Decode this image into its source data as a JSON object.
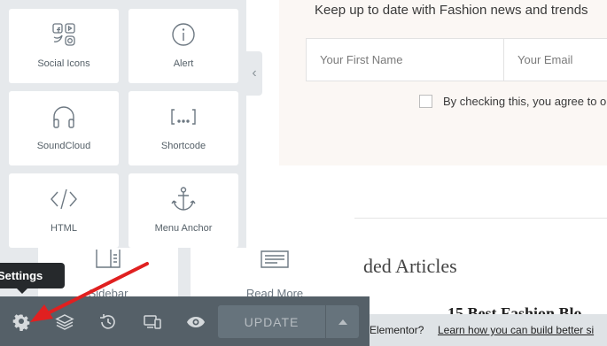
{
  "preview": {
    "newsletter_heading": "Keep up to date with Fashion news and trends",
    "first_name_placeholder": "Your First Name",
    "email_placeholder": "Your Email",
    "consent_text": "By checking this, you agree to o",
    "related_heading": "ded Articles",
    "post_title": "15 Best Fashion Blo",
    "notice_text": "g Elementor?",
    "notice_link": "Learn how you can build better si"
  },
  "panel": {
    "widgets": [
      {
        "label": "Social Icons",
        "icon": "social-icons-icon"
      },
      {
        "label": "Alert",
        "icon": "alert-icon"
      },
      {
        "label": "SoundCloud",
        "icon": "headphones-icon"
      },
      {
        "label": "Shortcode",
        "icon": "shortcode-icon"
      },
      {
        "label": "HTML",
        "icon": "code-icon"
      },
      {
        "label": "Menu Anchor",
        "icon": "anchor-icon"
      }
    ],
    "partial_widgets": [
      {
        "label": "Sidebar",
        "icon": "sidebar-icon"
      },
      {
        "label": "Read More",
        "icon": "read-more-icon"
      }
    ]
  },
  "footer": {
    "update_label": "UPDATE",
    "buttons": [
      "gear-icon",
      "layers-icon",
      "history-icon",
      "responsive-icon",
      "eye-icon"
    ]
  },
  "tooltip": {
    "label": "Settings"
  },
  "colors": {
    "panel_bg": "#e6e9ec",
    "footer_bg": "#556068",
    "annotation_arrow": "#e02020"
  }
}
